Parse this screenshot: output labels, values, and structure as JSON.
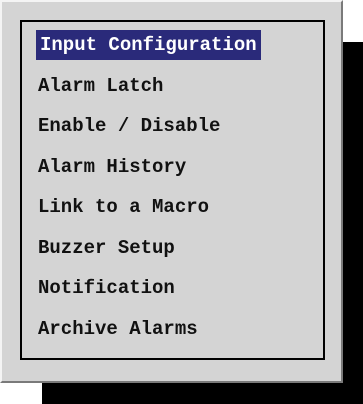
{
  "menu": {
    "colors": {
      "selected_background": "#2a2a7a",
      "selected_text": "#ffffff",
      "text": "#111111",
      "panel": "#d4d4d4"
    },
    "items": [
      {
        "label": "Input Configuration",
        "selected": true
      },
      {
        "label": "Alarm Latch",
        "selected": false
      },
      {
        "label": "Enable / Disable",
        "selected": false
      },
      {
        "label": "Alarm History",
        "selected": false
      },
      {
        "label": "Link to a Macro",
        "selected": false
      },
      {
        "label": "Buzzer Setup",
        "selected": false
      },
      {
        "label": "Notification",
        "selected": false
      },
      {
        "label": "Archive Alarms",
        "selected": false
      }
    ]
  }
}
